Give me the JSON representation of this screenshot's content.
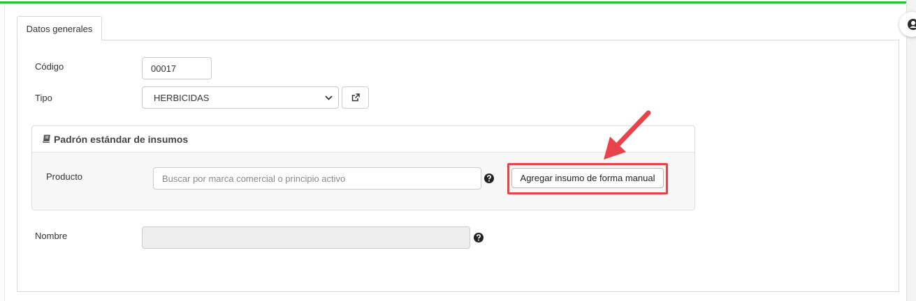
{
  "tabs": [
    {
      "label": "Datos generales",
      "active": true
    }
  ],
  "form": {
    "codigo": {
      "label": "Código",
      "value": "00017"
    },
    "tipo": {
      "label": "Tipo",
      "value": "HERBICIDAS"
    },
    "nombre": {
      "label": "Nombre",
      "value": ""
    }
  },
  "padron": {
    "title": "Padrón estándar de insumos",
    "producto_label": "Producto",
    "search_placeholder": "Buscar por marca comercial o principio activo",
    "manual_button": "Agregar insumo de forma manual"
  },
  "colors": {
    "accent_line": "#22c32e",
    "highlight": "#e8434a"
  },
  "icons": [
    "external-link-icon",
    "book-icon",
    "question-circle-icon",
    "user-icon",
    "chevron-down-icon"
  ]
}
